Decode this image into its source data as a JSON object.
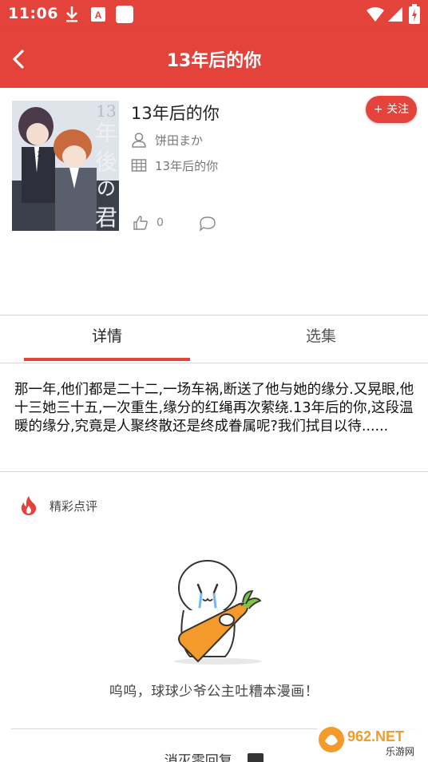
{
  "status_bar": {
    "time": "11:06"
  },
  "app_bar": {
    "title": "13年后的你"
  },
  "book": {
    "title": "13年后的你",
    "follow_label": "+ 关注",
    "author": "饼田まか",
    "category": "13年后的你",
    "likes": "0",
    "cover_text": "13年後の君"
  },
  "tabs": [
    {
      "label": "详情",
      "active": true
    },
    {
      "label": "选集",
      "active": false
    }
  ],
  "description": "那一年,他们都是二十二,一场车祸,断送了他与她的缘分.又晃眼,他十三她三十五,一次重生,缘分的红绳再次萦绕.13年后的你,这段温暖的缘分,究竟是人聚终散还是终成眷属呢?我们拭目以待......",
  "reviews": {
    "header": "精彩点评",
    "empty_text": "呜呜，球球少爷公主吐糟本漫画！",
    "bottom_label": "消灭零回复"
  },
  "watermark": {
    "main": "962.NET",
    "sub": "乐游网"
  },
  "colors": {
    "accent": "#e3433a",
    "text": "#222222",
    "muted": "#777777"
  }
}
